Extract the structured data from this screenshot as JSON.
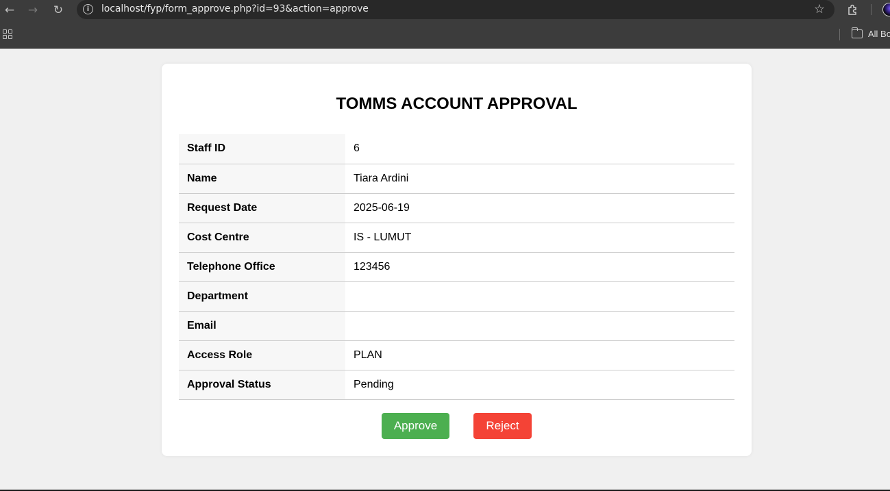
{
  "browser": {
    "url": "localhost/fyp/form_approve.php?id=93&action=approve",
    "bookmarks_label": "All Bookmarks"
  },
  "page": {
    "title": "TOMMS ACCOUNT APPROVAL",
    "rows": [
      {
        "label": "Staff ID",
        "value": "6"
      },
      {
        "label": "Name",
        "value": "Tiara Ardini"
      },
      {
        "label": "Request Date",
        "value": "2025-06-19"
      },
      {
        "label": "Cost Centre",
        "value": "IS - LUMUT"
      },
      {
        "label": "Telephone Office",
        "value": "123456"
      },
      {
        "label": "Department",
        "value": ""
      },
      {
        "label": "Email",
        "value": ""
      },
      {
        "label": "Access Role",
        "value": "PLAN"
      },
      {
        "label": "Approval Status",
        "value": "Pending"
      }
    ],
    "approve_label": "Approve",
    "reject_label": "Reject"
  },
  "colors": {
    "approve": "#4caf50",
    "reject": "#f44336"
  }
}
